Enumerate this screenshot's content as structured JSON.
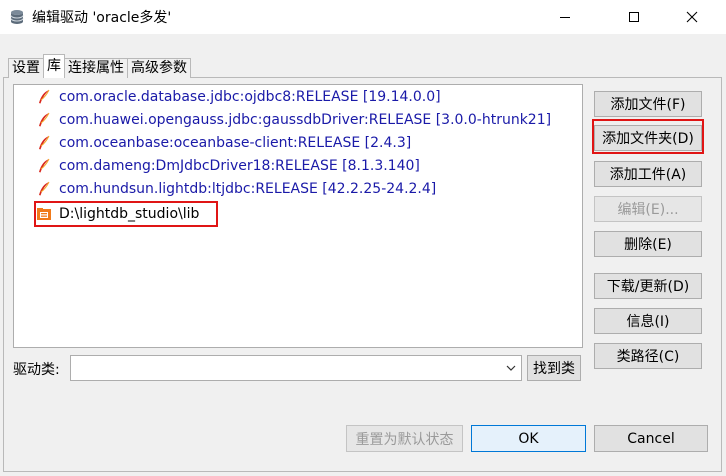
{
  "window": {
    "title": "编辑驱动 'oracle多发'"
  },
  "tabs": [
    {
      "label": "设置"
    },
    {
      "label": "库"
    },
    {
      "label": "连接属性"
    },
    {
      "label": "高级参数"
    }
  ],
  "libraries": [
    {
      "text": "com.oracle.database.jdbc:ojdbc8:RELEASE [19.14.0.0]",
      "icon": "maven-feather-icon"
    },
    {
      "text": "com.huawei.opengauss.jdbc:gaussdbDriver:RELEASE [3.0.0-htrunk21]",
      "icon": "maven-feather-icon"
    },
    {
      "text": "com.oceanbase:oceanbase-client:RELEASE [2.4.3]",
      "icon": "maven-feather-icon"
    },
    {
      "text": "com.dameng:DmJdbcDriver18:RELEASE [8.1.3.140]",
      "icon": "maven-feather-icon"
    },
    {
      "text": "com.hundsun.lightdb:ltjdbc:RELEASE [42.2.25-24.2.4]",
      "icon": "maven-feather-icon"
    },
    {
      "text": "D:\\lightdb_studio\\lib",
      "icon": "jar-folder-icon"
    }
  ],
  "buttons": {
    "add_file": "添加文件(F)",
    "add_folder": "添加文件夹(D)",
    "add_artifact": "添加工件(A)",
    "edit": "编辑(E)...",
    "delete": "删除(E)",
    "download_update": "下载/更新(D)",
    "info": "信息(I)",
    "class_path": "类路径(C)",
    "find_class": "找到类",
    "reset_default": "重置为默认状态",
    "ok": "OK",
    "cancel": "Cancel"
  },
  "driver_class": {
    "label": "驱动类:",
    "value": ""
  },
  "colors": {
    "highlight_red": "#e01515",
    "link_blue": "#1a1aa8",
    "feather_red": "#d9261c",
    "folder_orange": "#f07a1a"
  }
}
